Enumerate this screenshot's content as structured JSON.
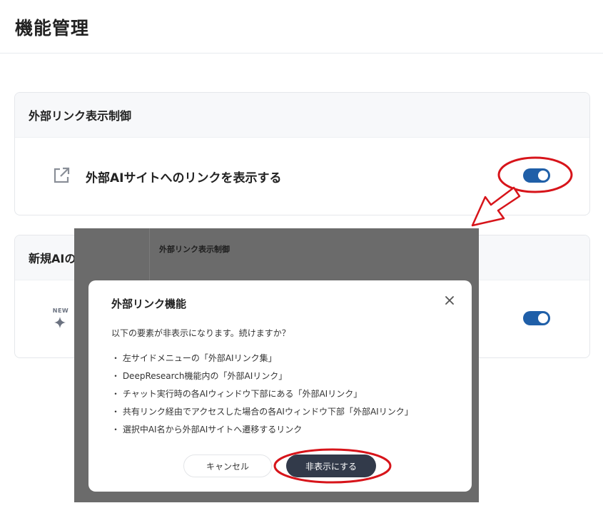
{
  "page": {
    "title": "機能管理"
  },
  "cards": {
    "external_link": {
      "header": "外部リンク表示制御",
      "row_label": "外部AIサイトへのリンクを表示する",
      "row_icon": "external-link-icon",
      "toggle_on": true
    },
    "new_ai": {
      "header": "新規AIの",
      "badge": "NEW",
      "badge_icon": "sparkle-icon",
      "toggle_on": true
    }
  },
  "overlay": {
    "header": "外部リンク表示制御",
    "dialog": {
      "title": "外部リンク機能",
      "message": "以下の要素が非表示になります。続けますか？",
      "items": [
        "・ 左サイドメニューの「外部AIリンク集」",
        "・ DeepResearch機能内の「外部AIリンク」",
        "・ チャット実行時の各AIウィンドウ下部にある「外部AIリンク」",
        "・ 共有リンク経由でアクセスした場合の各AIウィンドウ下部「外部AIリンク」",
        "・ 選択中AI名から外部AIサイトへ遷移するリンク"
      ],
      "cancel_label": "キャンセル",
      "confirm_label": "非表示にする",
      "close_icon": "close-icon"
    }
  },
  "colors": {
    "toggle_on": "#1f5fa8",
    "annotation_red": "#d7141a",
    "confirm_button": "#323a4a",
    "overlay_dim": "#6b6b6b"
  }
}
